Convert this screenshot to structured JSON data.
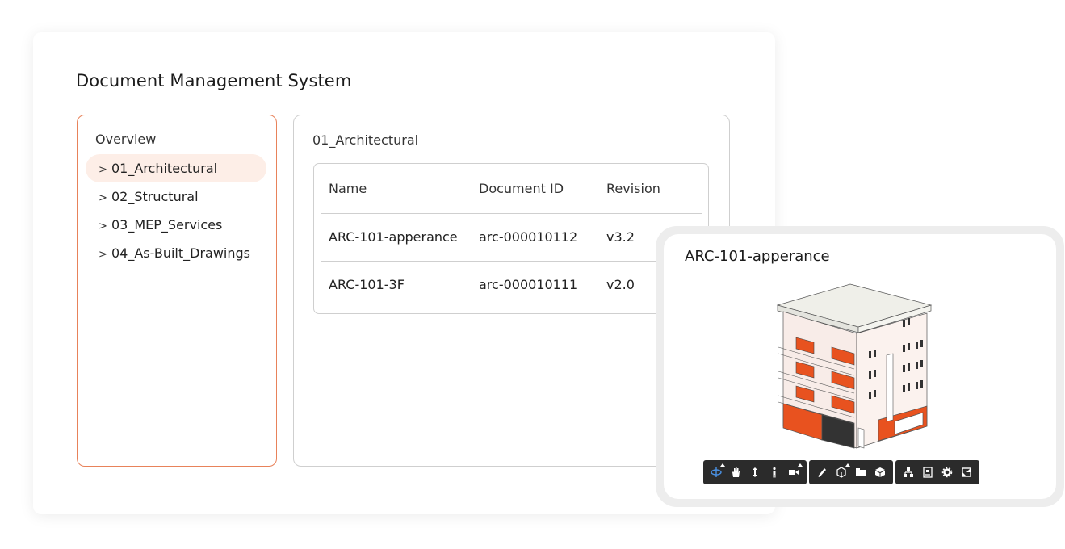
{
  "app": {
    "title": "Document Management System"
  },
  "sidebar": {
    "overview_label": "Overview",
    "chevron": ">",
    "items": [
      {
        "label": "01_Architectural",
        "active": true
      },
      {
        "label": "02_Structural"
      },
      {
        "label": "03_MEP_Services"
      },
      {
        "label": "04_As-Built_Drawings"
      }
    ]
  },
  "content": {
    "folder_title": "01_Architectural",
    "table": {
      "headers": {
        "name": "Name",
        "doc_id": "Document ID",
        "revision": "Revision"
      },
      "rows": [
        {
          "name": "ARC-101-apperance",
          "doc_id": "arc-000010112",
          "revision": "v3.2"
        },
        {
          "name": "ARC-101-3F",
          "doc_id": "arc-000010111",
          "revision": "v2.0"
        }
      ]
    }
  },
  "preview": {
    "title": "ARC-101-apperance",
    "accent_color": "#e8521f",
    "toolbar_icons": [
      [
        "orbit-icon",
        "pan-hand-icon",
        "dolly-icon",
        "first-person-icon",
        "camera-icon"
      ],
      [
        "measure-icon",
        "section-box-icon",
        "explode-icon",
        "model-cube-icon"
      ],
      [
        "model-tree-icon",
        "properties-icon",
        "settings-icon",
        "fullscreen-icon"
      ]
    ]
  },
  "colors": {
    "panel_border_active": "#e8825a",
    "active_item_bg": "#fdeee7",
    "border_gray": "#cfcfcf",
    "toolbar_bg": "#2b2b2b",
    "toolbar_active": "#4a90e2"
  }
}
